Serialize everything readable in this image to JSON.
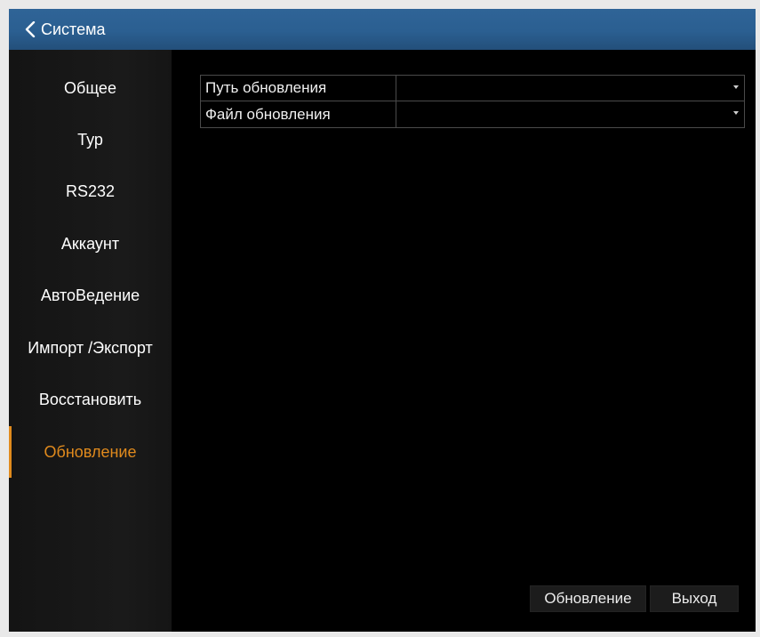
{
  "header": {
    "title": "Система",
    "back_icon": "chevron-left-icon"
  },
  "sidebar": {
    "items": [
      {
        "label": "Общее",
        "active": false
      },
      {
        "label": "Тур",
        "active": false
      },
      {
        "label": "RS232",
        "active": false
      },
      {
        "label": "Аккаунт",
        "active": false
      },
      {
        "label": "АвтоВедение",
        "active": false
      },
      {
        "label": "Импорт /Экспорт",
        "active": false
      },
      {
        "label": "Восстановить",
        "active": false
      },
      {
        "label": "Обновление",
        "active": true
      }
    ]
  },
  "form": {
    "rows": [
      {
        "label": "Путь обновления",
        "value": ""
      },
      {
        "label": "Файл обновления",
        "value": ""
      }
    ]
  },
  "buttons": {
    "update_label": "Обновление",
    "exit_label": "Выход"
  },
  "colors": {
    "title_bar": "#2b5f91",
    "accent": "#e08a1d",
    "sidebar_bg": "#1a1a1a",
    "content_bg": "#000000"
  }
}
